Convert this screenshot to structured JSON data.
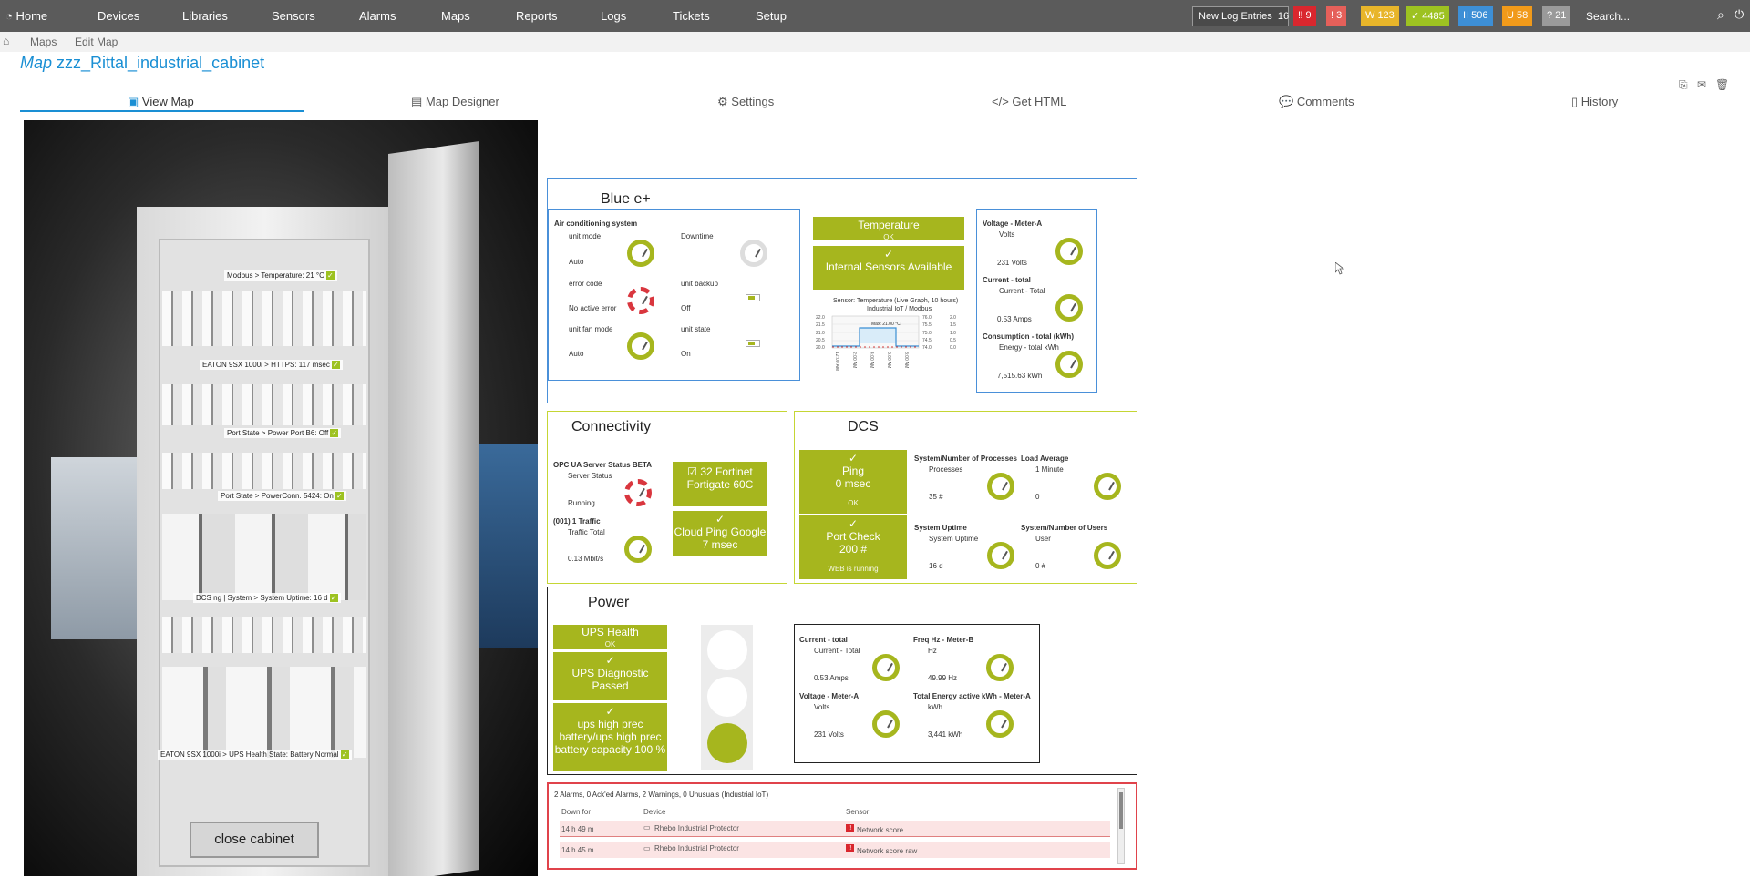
{
  "nav": {
    "home": "Home",
    "items": [
      "Devices",
      "Libraries",
      "Sensors",
      "Alarms",
      "Maps",
      "Reports",
      "Logs",
      "Tickets",
      "Setup"
    ],
    "log_label": "New Log Entries",
    "log_count": "16",
    "badges": [
      {
        "text": "‼ 9",
        "color": "#d9272e"
      },
      {
        "text": "! 3",
        "color": "#e5605a"
      },
      {
        "text": "W 123",
        "color": "#e8b52a"
      },
      {
        "text": "✓ 4485",
        "color": "#9dc221"
      },
      {
        "text": "II 506",
        "color": "#3d8fd6"
      },
      {
        "text": "U 58",
        "color": "#f19a1a"
      },
      {
        "text": "? 21",
        "color": "#9a9a9a"
      }
    ],
    "search_placeholder": "Search..."
  },
  "breadcrumb": {
    "maps": "Maps",
    "edit": "Edit Map"
  },
  "page": {
    "prefix": "Map",
    "name": "zzz_Rittal_industrial_cabinet"
  },
  "tabs": [
    "View Map",
    "Map Designer",
    "Settings",
    "Get HTML",
    "Comments",
    "History"
  ],
  "photo": {
    "labels": [
      "Modbus > Temperature: 21 °C",
      "EATON 9SX 1000i > HTTPS: 117 msec",
      "Port State > Power Port B6: Off",
      "Port State > PowerConn. 5424: On",
      "DCS ng | System > System Uptime: 16 d",
      "EATON 9SX 1000i > UPS Health State: Battery Normal"
    ],
    "close_button": "close cabinet"
  },
  "blue": {
    "title": "Blue e+",
    "ac_title": "Air conditioning system",
    "unit_mode": "unit mode",
    "unit_mode_val": "Auto",
    "downtime": "Downtime",
    "error_code": "error code",
    "error_code_val": "No active error",
    "unit_backup": "unit backup",
    "unit_backup_val": "Off",
    "fan_mode": "unit fan mode",
    "fan_mode_val": "Auto",
    "unit_state": "unit state",
    "unit_state_val": "On",
    "temp_title": "Temperature",
    "temp_sub": "OK",
    "internal": "Internal Sensors Available",
    "graph_title": "Sensor: Temperature (Live Graph, 10 hours)",
    "graph_sub": "Industrial IoT / Modbus",
    "graph_max": "Max: 21.00 °C",
    "graph_y1": [
      "22.0",
      "21.5",
      "21.0",
      "20.5",
      "20.0"
    ],
    "graph_y2": [
      "76.0",
      "75.5",
      "75.0",
      "74.5",
      "74.0"
    ],
    "graph_y3": [
      "2.0",
      "1.5",
      "1.0",
      "0.5",
      "0.0"
    ],
    "graph_x": [
      "12:00 AM",
      "2:00 AM",
      "4:00 AM",
      "6:00 AM",
      "8:00 AM"
    ],
    "volt_title": "Voltage - Meter-A",
    "volt_sub": "Volts",
    "volt_val": "231 Volts",
    "cur_title": "Current - total",
    "cur_sub": "Current - Total",
    "cur_val": "0.53 Amps",
    "cons_title": "Consumption - total (kWh)",
    "cons_sub": "Energy - total kWh",
    "cons_val": "7,515.63 kWh"
  },
  "conn": {
    "title": "Connectivity",
    "opc_title": "OPC UA Server Status BETA",
    "opc_sub": "Server Status",
    "opc_val": "Running",
    "traffic_title": "(001) 1 Traffic",
    "traffic_sub": "Traffic Total",
    "traffic_val": "0.13 Mbit/s",
    "fortinet": "32 Fortinet Fortigate 60C",
    "cloud": "Cloud Ping Google 7 msec"
  },
  "dcs": {
    "title": "DCS",
    "ping": "Ping",
    "ping_val": "0 msec",
    "ping_ok": "OK",
    "port": "Port Check",
    "port_val": "200 #",
    "port_sub": "WEB is running",
    "proc_title": "System/Number of Processes",
    "proc_sub": "Processes",
    "proc_val": "35 #",
    "load_title": "Load Average",
    "load_sub": "1 Minute",
    "load_val": "0",
    "uptime_title": "System Uptime",
    "uptime_sub": "System Uptime",
    "uptime_val": "16 d",
    "users_title": "System/Number of Users",
    "users_sub": "User",
    "users_val": "0 #"
  },
  "power": {
    "title": "Power",
    "ups_health": "UPS Health",
    "ups_health_sub": "OK",
    "ups_diag": "UPS Diagnostic Passed",
    "ups_bat": "ups high prec battery/ups high prec battery capacity 100 %",
    "cur_title": "Current - total",
    "cur_sub": "Current - Total",
    "cur_val": "0.53 Amps",
    "freq_title": "Freq Hz - Meter-B",
    "freq_sub": "Hz",
    "freq_val": "49.99 Hz",
    "volt_title": "Voltage - Meter-A",
    "volt_sub": "Volts",
    "volt_val": "231 Volts",
    "energy_title": "Total Energy active kWh - Meter-A",
    "energy_sub": "kWh",
    "energy_val": "3,441 kWh"
  },
  "alarms": {
    "summary": "2 Alarms, 0 Ack'ed Alarms, 2 Warnings, 0 Unusuals (Industrial IoT)",
    "headers": [
      "Down for",
      "Device",
      "Sensor"
    ],
    "rows": [
      {
        "down": "14 h 49 m",
        "device": "Rhebo Industrial Protector",
        "sensor": "Network score"
      },
      {
        "down": "14 h 45 m",
        "device": "Rhebo Industrial Protector",
        "sensor": "Network score raw"
      }
    ]
  },
  "colors": {
    "accent": "#1a8fd4",
    "gauge": "#a6b61e",
    "alarm": "#d9272e"
  }
}
